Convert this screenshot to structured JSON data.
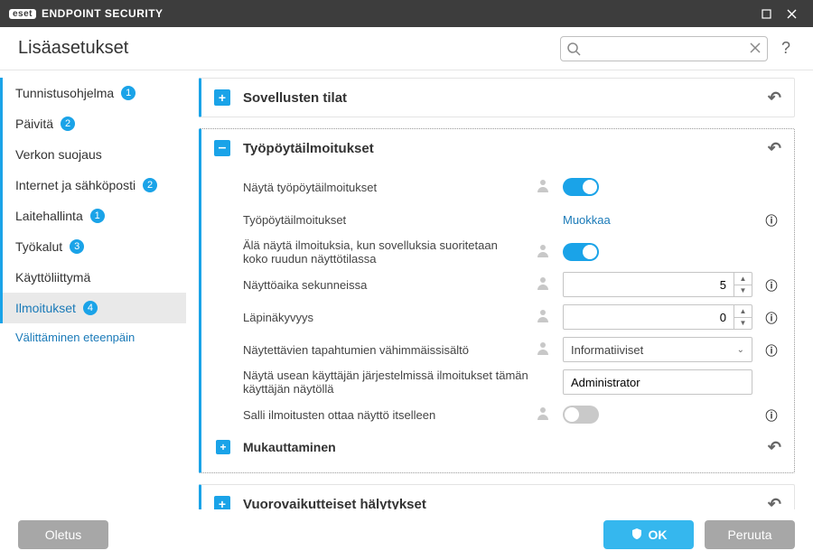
{
  "titlebar": {
    "brand_pill": "eset",
    "brand_text": "ENDPOINT SECURITY"
  },
  "header": {
    "title": "Lisäasetukset",
    "search_placeholder": ""
  },
  "sidebar": {
    "items": [
      {
        "label": "Tunnistusohjelma",
        "badge": "1"
      },
      {
        "label": "Päivitä",
        "badge": "2"
      },
      {
        "label": "Verkon suojaus",
        "badge": ""
      },
      {
        "label": "Internet ja sähköposti",
        "badge": "2"
      },
      {
        "label": "Laitehallinta",
        "badge": "1"
      },
      {
        "label": "Työkalut",
        "badge": "3"
      },
      {
        "label": "Käyttöliittymä",
        "badge": ""
      },
      {
        "label": "Ilmoitukset",
        "badge": "4"
      }
    ],
    "sublink": "Välittäminen eteenpäin"
  },
  "sections": {
    "app_states": {
      "title": "Sovellusten tilat"
    },
    "desktop_notifications": {
      "title": "Työpöytäilmoitukset",
      "rows": {
        "show_desktop": {
          "label": "Näytä työpöytäilmoitukset",
          "value": "on"
        },
        "desktop_notifications": {
          "label": "Työpöytäilmoitukset",
          "link": "Muokkaa"
        },
        "no_fullscreen": {
          "label": "Älä näytä ilmoituksia, kun sovelluksia suoritetaan koko ruudun näyttötilassa",
          "value": "on"
        },
        "display_seconds": {
          "label": "Näyttöaika sekunneissa",
          "value": "5"
        },
        "transparency": {
          "label": "Läpinäkyvyys",
          "value": "0"
        },
        "min_severity": {
          "label": "Näytettävien tapahtumien vähimmäissisältö",
          "value": "Informatiiviset"
        },
        "multiuser_display": {
          "label": "Näytä usean käyttäjän järjestelmissä ilmoitukset tämän käyttäjän näytöllä",
          "value": "Administrator"
        },
        "allow_focus": {
          "label": "Salli ilmoitusten ottaa näyttö itselleen",
          "value": "off"
        }
      },
      "subsection": {
        "title": "Mukauttaminen"
      }
    },
    "interactive_alerts": {
      "title": "Vuorovaikutteiset hälytykset"
    }
  },
  "footer": {
    "default": "Oletus",
    "ok": "OK",
    "cancel": "Peruuta"
  },
  "glyphs": {
    "info": "ⓘ",
    "revert": "↶",
    "help": "?",
    "caret": "⌄"
  }
}
